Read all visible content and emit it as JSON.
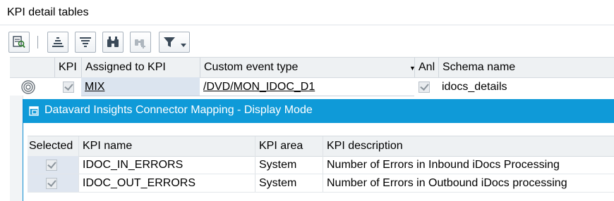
{
  "page": {
    "title": "KPI detail tables"
  },
  "toolbar": {
    "buttons": [
      {
        "icon": "details-icon"
      },
      {
        "icon": "sort-ascending-icon"
      },
      {
        "icon": "sort-descending-icon"
      },
      {
        "icon": "binoculars-icon"
      },
      {
        "icon": "find-next-icon"
      },
      {
        "icon": "filter-icon"
      }
    ]
  },
  "grid": {
    "columns": [
      "KPI",
      "Assigned to KPI",
      "Custom event type",
      "Anl",
      "Schema name"
    ],
    "row": {
      "assigned": "MIX",
      "event_type": "/DVD/MON_IDOC_D1",
      "schema": "idocs_details"
    }
  },
  "popup": {
    "title": "Datavard Insights Connector Mapping - Display Mode",
    "columns": [
      "Selected",
      "KPI name",
      "KPI area",
      "KPI description"
    ],
    "rows": [
      {
        "name": "IDOC_IN_ERRORS",
        "area": "System",
        "description": "Number of Errors in Inbound iDocs Processing"
      },
      {
        "name": "IDOC_OUT_ERRORS",
        "area": "System",
        "description": "Number of Errors in Outbound iDocs processing"
      }
    ]
  },
  "colors": {
    "accent": "#0f9ad8",
    "header_bg": "#eef1f3"
  }
}
